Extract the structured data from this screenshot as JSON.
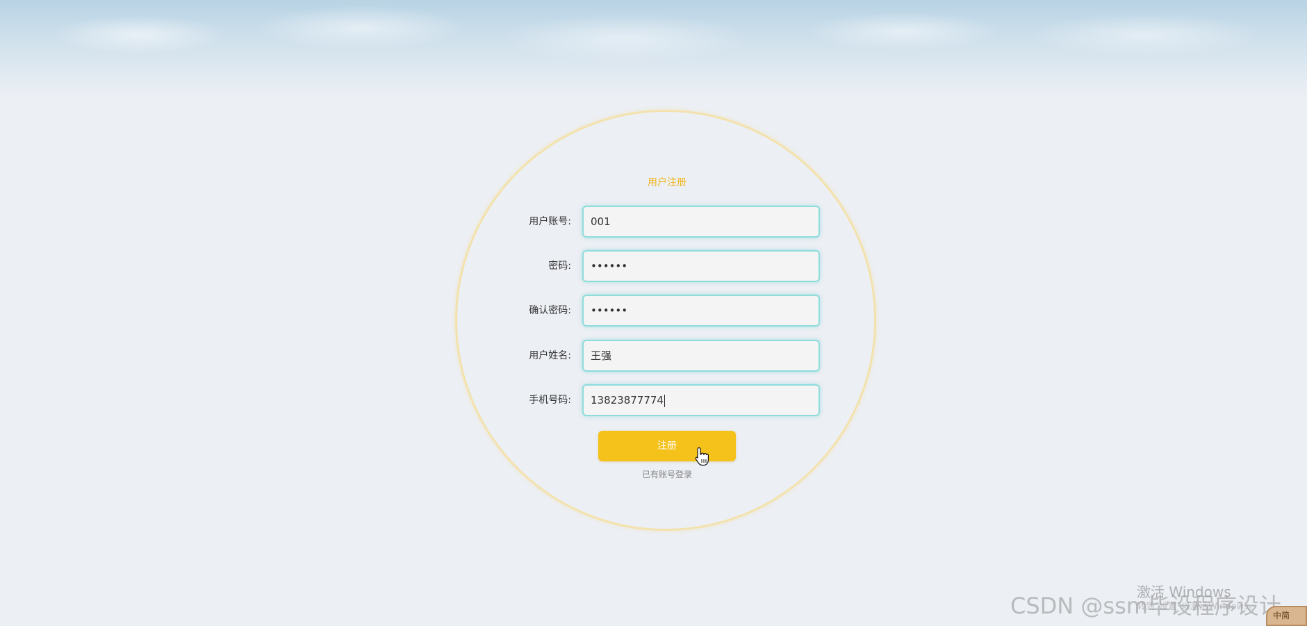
{
  "form": {
    "title": "用户注册",
    "fields": [
      {
        "label": "用户账号:",
        "value": "001"
      },
      {
        "label": "密码:",
        "value": "••••••"
      },
      {
        "label": "确认密码:",
        "value": "••••••"
      },
      {
        "label": "用户姓名:",
        "value": "王强"
      },
      {
        "label": "手机号码:",
        "value": "13823877774"
      }
    ],
    "submit_label": "注册",
    "login_link": "已有账号登录"
  },
  "overlay": {
    "windows_activate": "激活 Windows",
    "windows_activate_sub": "转到\"设置\"以激活Windows。",
    "csdn_watermark": "CSDN @ssm毕设程序设计",
    "ime_label": "中简"
  },
  "colors": {
    "accent": "#f5c11b",
    "title": "#efb51b",
    "input_border": "#8fdcdb",
    "circle_border": "#f3e2ad",
    "background": "#eceff4"
  }
}
